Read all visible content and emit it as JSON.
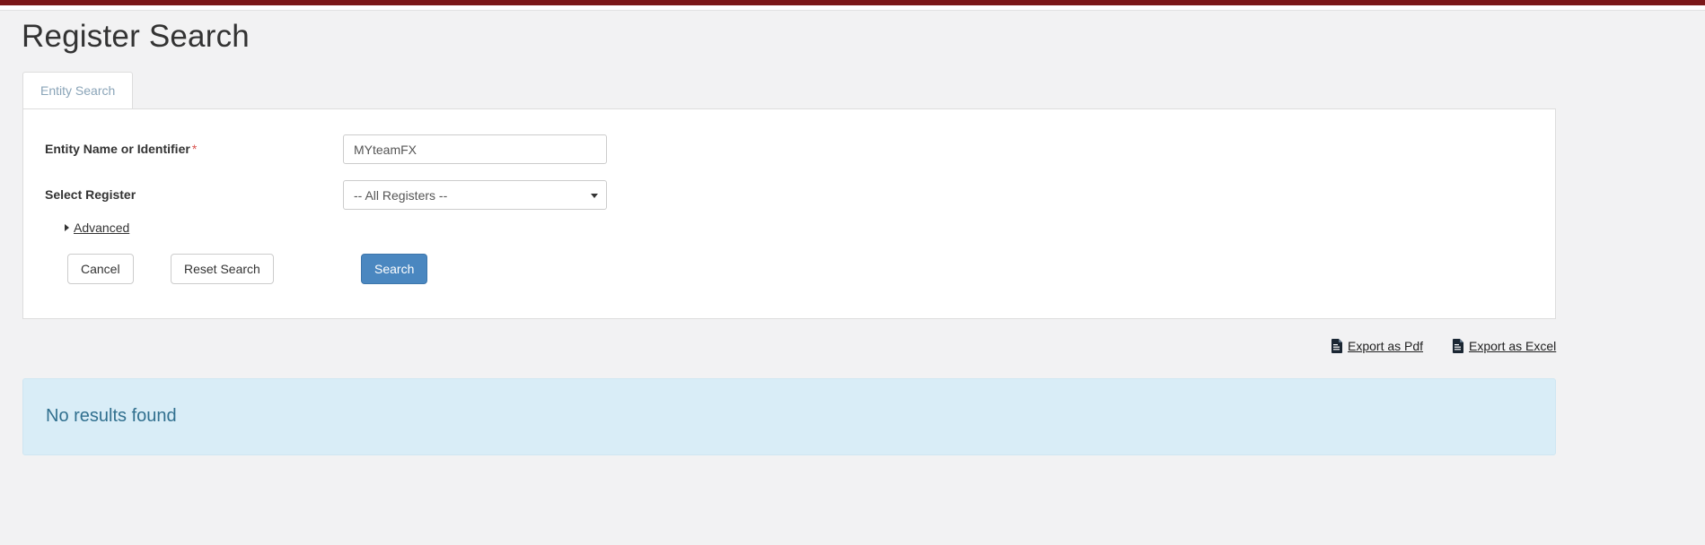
{
  "theme": {
    "accent_bar_color": "#7b1718",
    "primary_button_color": "#4a87c0",
    "info_panel_color": "#d9edf7",
    "info_text_color": "#31708f",
    "required_marker_color": "#d9534f",
    "page_background": "#f2f2f3"
  },
  "header": {
    "title": "Register Search"
  },
  "tabs": [
    {
      "label": "Entity Search",
      "active": true
    }
  ],
  "form": {
    "fields": [
      {
        "label": "Entity Name or Identifier",
        "required": true,
        "required_marker": "*",
        "type": "text",
        "value": "MYteamFX",
        "placeholder": ""
      },
      {
        "label": "Select Register",
        "required": false,
        "required_marker": "",
        "type": "select",
        "value": "-- All Registers --",
        "placeholder": ""
      }
    ],
    "advanced": {
      "label": "Advanced",
      "expanded": false,
      "caret": "triangle-right"
    },
    "buttons": {
      "cancel_label": "Cancel",
      "reset_label": "Reset Search",
      "search_label": "Search"
    }
  },
  "exports": [
    {
      "label": "Export as Pdf",
      "icon": "file-pdf-icon"
    },
    {
      "label": "Export as Excel",
      "icon": "file-excel-icon"
    }
  ],
  "results": {
    "message": "No results found"
  }
}
